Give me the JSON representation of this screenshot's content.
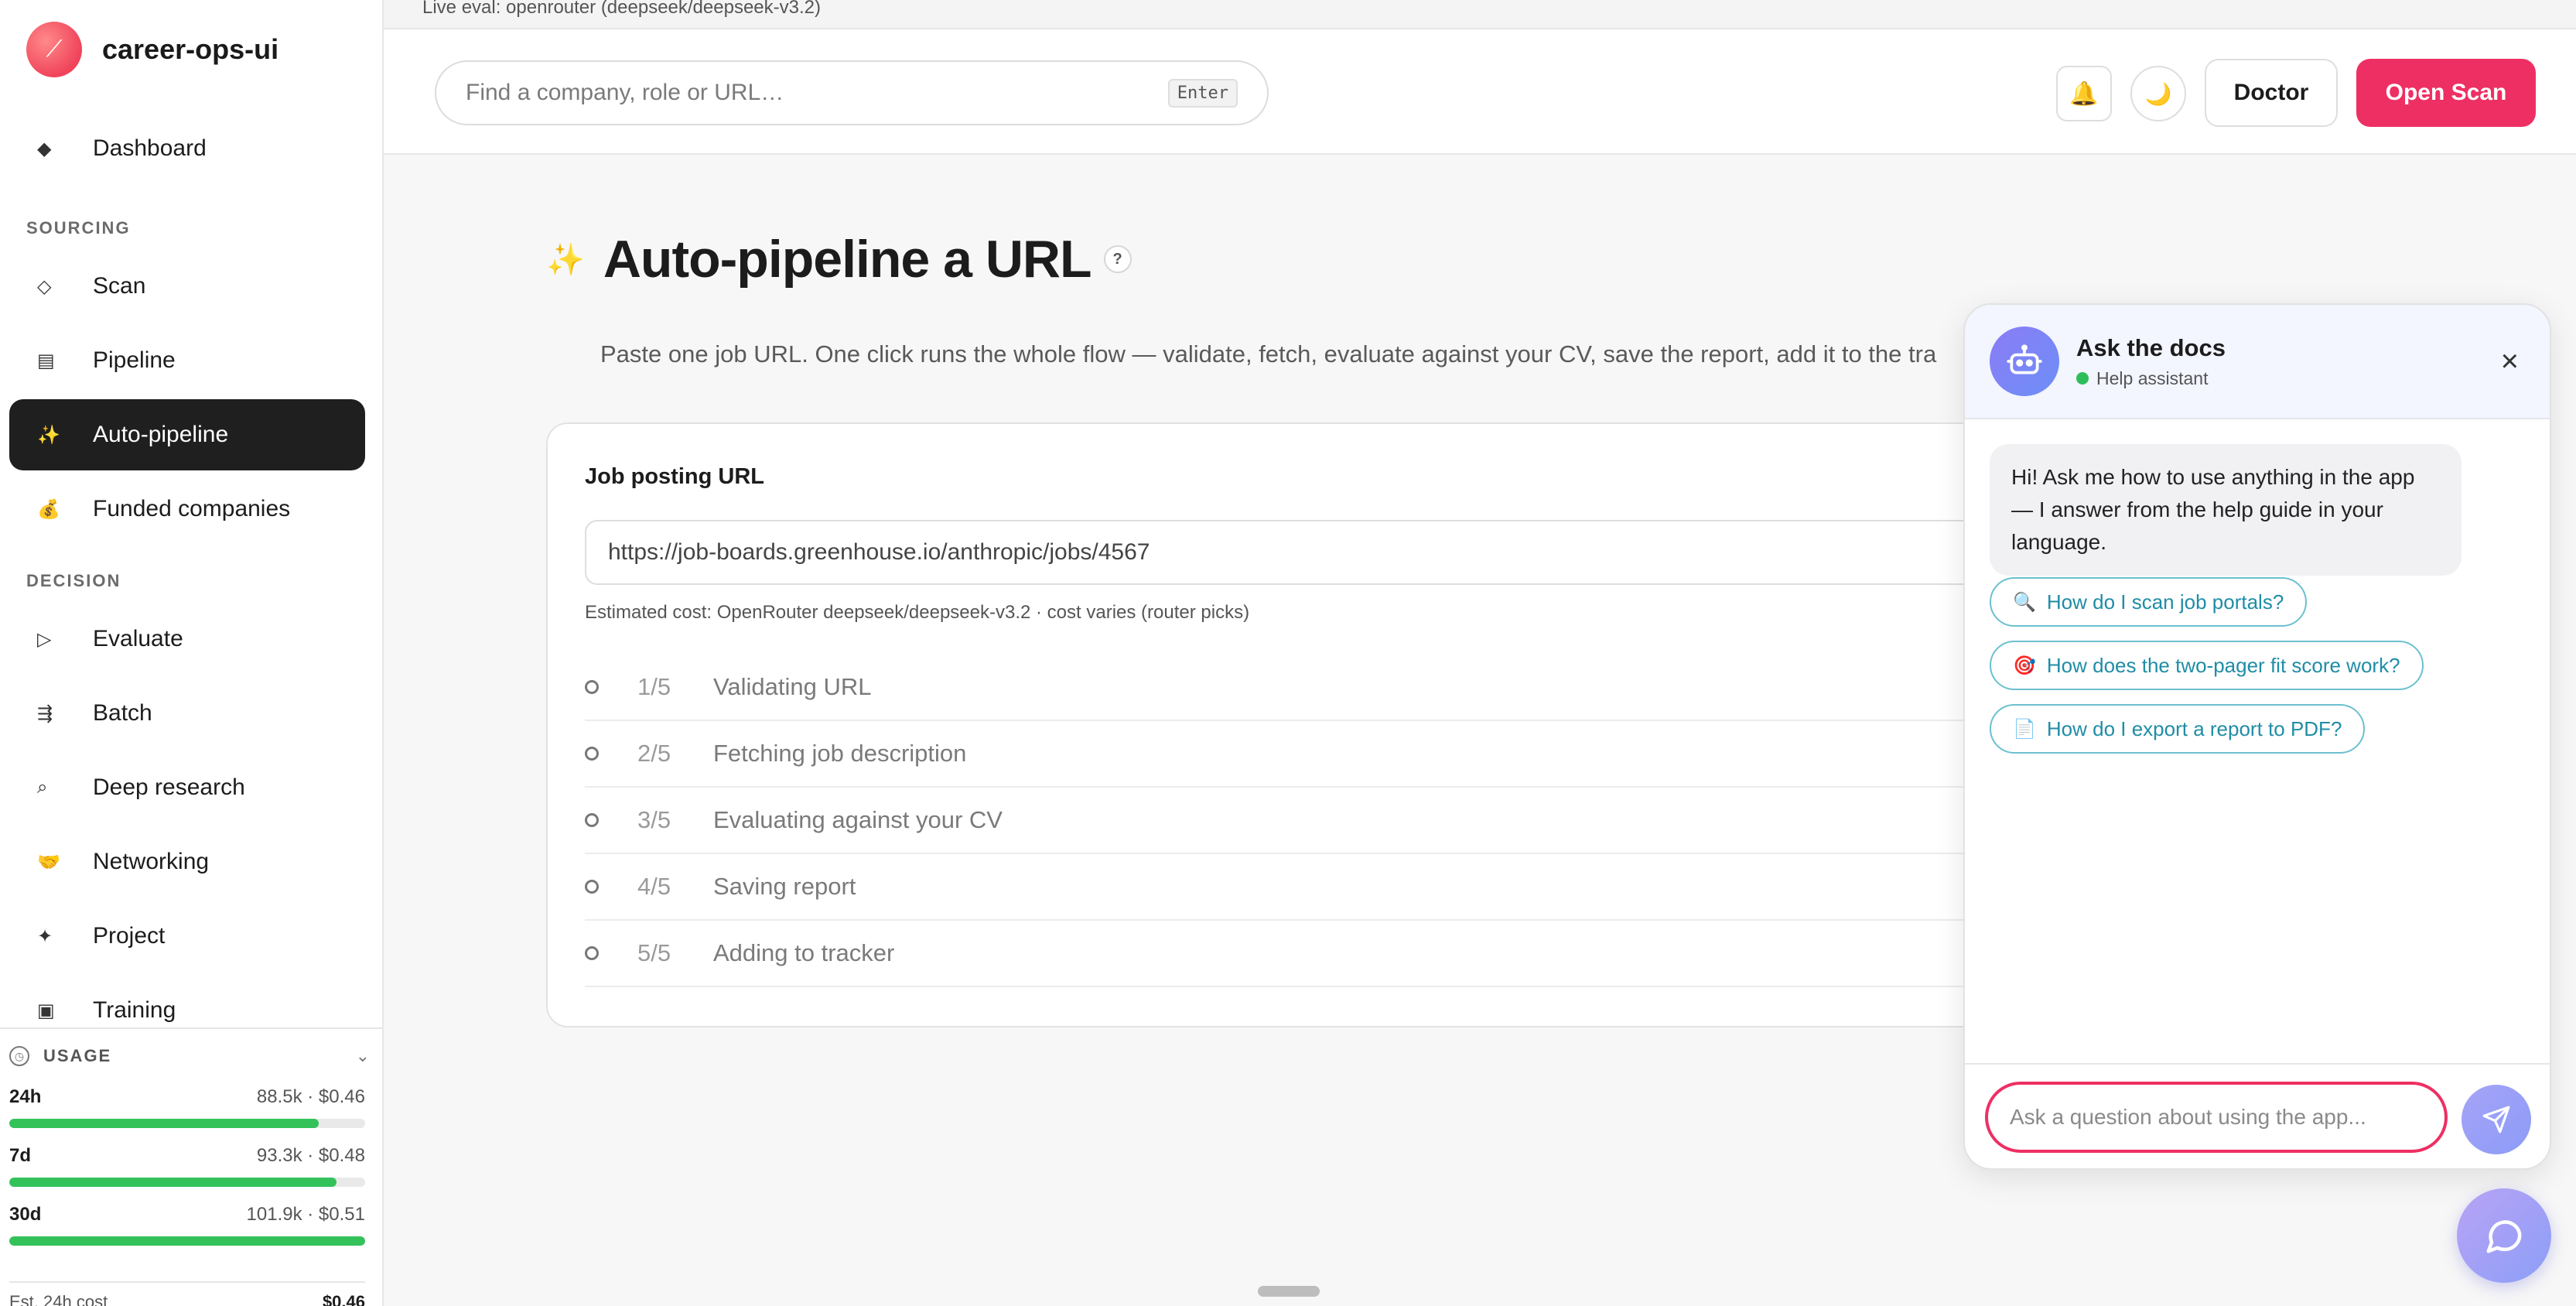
{
  "app": {
    "name": "career-ops-ui"
  },
  "live_eval": "Live eval: openrouter (deepseek/deepseek-v3.2)",
  "sidebar": {
    "top_item": {
      "label": "Dashboard",
      "icon": "diamond-icon"
    },
    "sections": [
      {
        "title": "SOURCING",
        "items": [
          {
            "label": "Scan",
            "icon": "diamond-outline-icon"
          },
          {
            "label": "Pipeline",
            "icon": "list-icon"
          },
          {
            "label": "Auto-pipeline",
            "icon": "sparkles-icon",
            "active": true
          },
          {
            "label": "Funded companies",
            "icon": "money-bag-icon"
          }
        ]
      },
      {
        "title": "DECISION",
        "items": [
          {
            "label": "Evaluate",
            "icon": "play-outline-icon"
          },
          {
            "label": "Batch",
            "icon": "batch-icon"
          },
          {
            "label": "Deep research",
            "icon": "magnifier-icon"
          },
          {
            "label": "Networking",
            "icon": "handshake-icon"
          },
          {
            "label": "Project",
            "icon": "star-icon"
          },
          {
            "label": "Training",
            "icon": "square-icon"
          }
        ]
      }
    ]
  },
  "usage": {
    "title": "USAGE",
    "rows": [
      {
        "period": "24h",
        "value": "88.5k · $0.46",
        "fill": 0.87
      },
      {
        "period": "7d",
        "value": "93.3k · $0.48",
        "fill": 0.92
      },
      {
        "period": "30d",
        "value": "101.9k · $0.51",
        "fill": 1.0
      }
    ],
    "footer_label": "Est. 24h cost",
    "footer_value": "$0.46"
  },
  "topbar": {
    "search_placeholder": "Find a company, role or URL…",
    "search_hint": "Enter",
    "doctor_label": "Doctor",
    "scan_label": "Open Scan",
    "accent": "#ee2f63"
  },
  "main": {
    "title": "Auto-pipeline a URL",
    "help": "?",
    "subtitle": "Paste one job URL. One click runs the whole flow — validate, fetch, evaluate against your CV, save the report, add it to the tra",
    "field_label": "Job posting URL",
    "url_value": "https://job-boards.greenhouse.io/anthropic/jobs/4567",
    "cost_note": "Estimated cost: OpenRouter deepseek/deepseek-v3.2 · cost varies (router picks)",
    "steps": [
      {
        "num": "1/5",
        "label": "Validating URL"
      },
      {
        "num": "2/5",
        "label": "Fetching job description"
      },
      {
        "num": "3/5",
        "label": "Evaluating against your CV"
      },
      {
        "num": "4/5",
        "label": "Saving report"
      },
      {
        "num": "5/5",
        "label": "Adding to tracker"
      }
    ]
  },
  "chat": {
    "title": "Ask the docs",
    "status": "Help assistant",
    "greeting": "Hi! Ask me how to use anything in the app — I answer from the help guide in your language.",
    "suggestions": [
      {
        "icon": "🔍",
        "label": "How do I scan job portals?"
      },
      {
        "icon": "🎯",
        "label": "How does the two-pager fit score work?"
      },
      {
        "icon": "📄",
        "label": "How do I export a report to PDF?"
      }
    ],
    "input_placeholder": "Ask a question about using the app..."
  }
}
